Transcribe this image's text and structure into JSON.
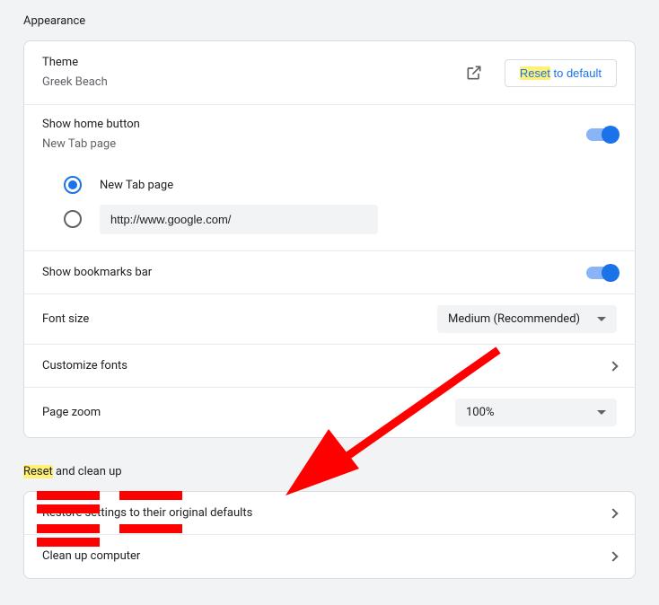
{
  "appearance": {
    "title": "Appearance",
    "theme": {
      "label": "Theme",
      "name": "Greek Beach",
      "reset_hl": "Reset",
      "reset_rest": " to default"
    },
    "home": {
      "label": "Show home button",
      "sub": "New Tab page",
      "opt_newtab": "New Tab page",
      "opt_url_value": "http://www.google.com/"
    },
    "bookmarks": {
      "label": "Show bookmarks bar"
    },
    "font_size": {
      "label": "Font size",
      "value": "Medium (Recommended)"
    },
    "customize_fonts": {
      "label": "Customize fonts"
    },
    "page_zoom": {
      "label": "Page zoom",
      "value": "100%"
    }
  },
  "reset_section": {
    "title_hl": "Reset",
    "title_rest": " and clean up",
    "restore": "Restore settings to their original defaults",
    "cleanup": "Clean up computer"
  },
  "annotation": {
    "arrow_color": "#ff0000"
  }
}
